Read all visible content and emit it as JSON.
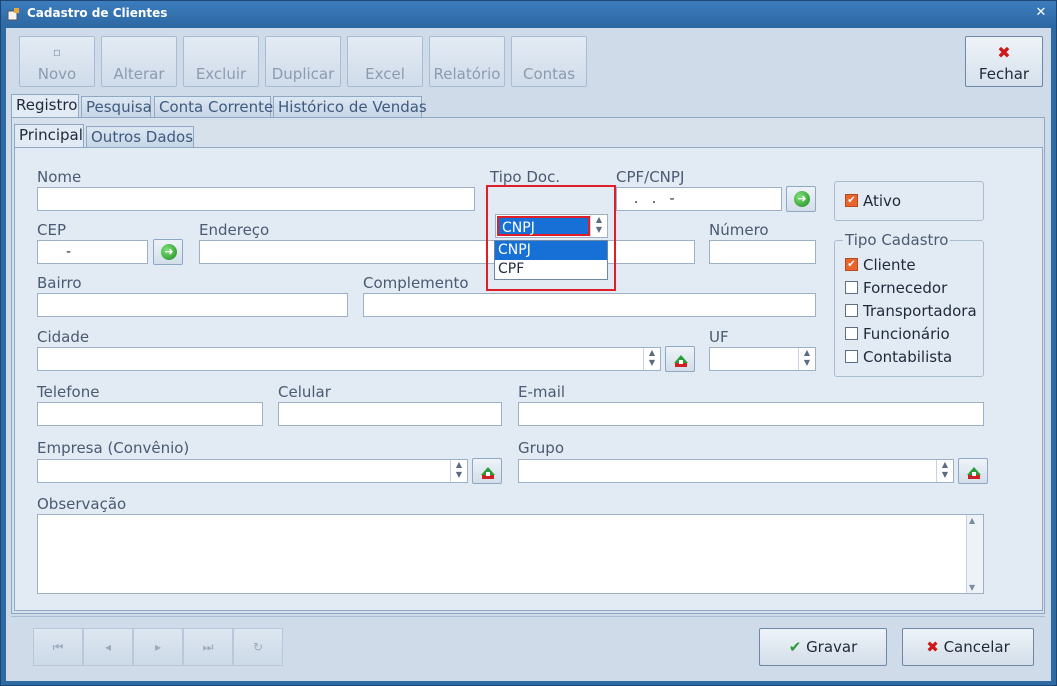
{
  "window": {
    "title": "Cadastro de Clientes",
    "close_glyph": "✕"
  },
  "toolbar": {
    "novo": "Novo",
    "alterar": "Alterar",
    "excluir": "Excluir",
    "duplicar": "Duplicar",
    "excel": "Excel",
    "relatorio": "Relatório",
    "contas": "Contas",
    "fechar": "Fechar",
    "fechar_glyph": "✖"
  },
  "tabs": {
    "main": [
      "Registro",
      "Pesquisa",
      "Conta Corrente",
      "Histórico de Vendas"
    ],
    "sub": [
      "Principal",
      "Outros Dados"
    ]
  },
  "form": {
    "nome": {
      "label": "Nome",
      "value": ""
    },
    "tipo_doc": {
      "label": "Tipo Doc.",
      "value": "CNPJ",
      "options": [
        "CNPJ",
        "CPF"
      ]
    },
    "cpf_cnpj": {
      "label": "CPF/CNPJ",
      "value": "  .   .   -"
    },
    "cep": {
      "label": "CEP",
      "value": "-"
    },
    "endereco": {
      "label": "Endereço",
      "value": ""
    },
    "numero": {
      "label": "Número",
      "value": ""
    },
    "bairro": {
      "label": "Bairro",
      "value": ""
    },
    "complemento": {
      "label": "Complemento",
      "value": ""
    },
    "cidade": {
      "label": "Cidade",
      "value": ""
    },
    "uf": {
      "label": "UF",
      "value": ""
    },
    "telefone": {
      "label": "Telefone",
      "value": ""
    },
    "celular": {
      "label": "Celular",
      "value": ""
    },
    "email": {
      "label": "E-mail",
      "value": ""
    },
    "empresa": {
      "label": "Empresa (Convênio)",
      "value": ""
    },
    "grupo": {
      "label": "Grupo",
      "value": ""
    },
    "observacao": {
      "label": "Observação",
      "value": ""
    }
  },
  "ativo": {
    "label": "Ativo",
    "checked": true
  },
  "tipo_cadastro": {
    "title": "Tipo Cadastro",
    "items": [
      {
        "label": "Cliente",
        "checked": true
      },
      {
        "label": "Fornecedor",
        "checked": false
      },
      {
        "label": "Transportadora",
        "checked": false
      },
      {
        "label": "Funcionário",
        "checked": false
      },
      {
        "label": "Contabilista",
        "checked": false
      }
    ]
  },
  "footer": {
    "gravar": "Gravar",
    "cancelar": "Cancelar",
    "gravar_glyph": "✔",
    "cancelar_glyph": "✖"
  },
  "colors": {
    "accent": "#1670d6",
    "highlight": "#e01e28",
    "check_on": "#e8652e"
  }
}
